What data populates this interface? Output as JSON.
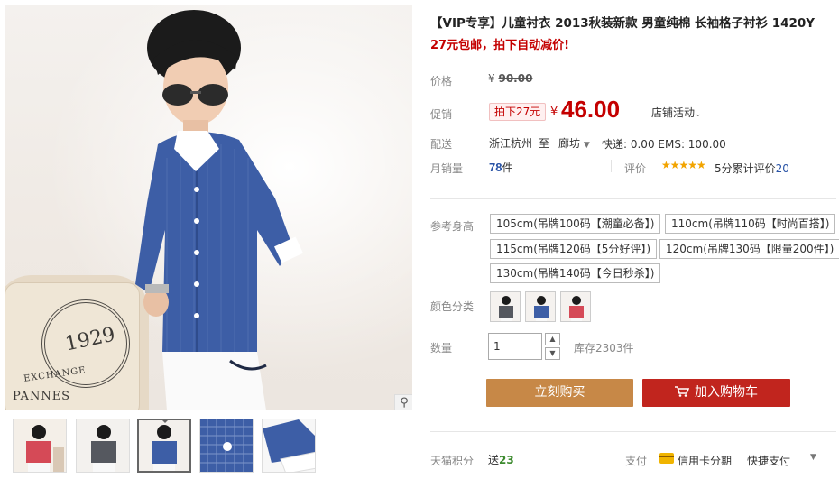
{
  "product": {
    "title": "【VIP专享】儿童衬衣 2013秋装新款 男童纯棉 长袖格子衬衫 1420Y",
    "subtitle": "27元包邮，拍下自动减价!"
  },
  "price": {
    "label": "价格",
    "original": "90.00",
    "currency_symbol": "¥"
  },
  "promo": {
    "label": "促销",
    "tag": "拍下27元",
    "currency_symbol": "¥",
    "price": "46.00",
    "shop_activity": "店铺活动"
  },
  "delivery": {
    "label": "配送",
    "from": "浙江杭州",
    "to_word": "至",
    "destination": "廊坊",
    "shipping": "快递: 0.00 EMS: 100.00"
  },
  "sales": {
    "label": "月销量",
    "count": "78",
    "unit": "件",
    "rating_label": "评价",
    "stars": "★★★★★",
    "score_text": "5分",
    "cumulative_text": "累计评价",
    "review_count": "20"
  },
  "size": {
    "label": "参考身高",
    "options": [
      "105cm(吊牌100码【潮童必备】)",
      "110cm(吊牌110码【时尚百搭】)",
      "115cm(吊牌120码【5分好评】)",
      "120cm(吊牌130码【限量200件】)",
      "130cm(吊牌140码【今日秒杀】)"
    ]
  },
  "color": {
    "label": "颜色分类",
    "options": [
      "gray-shirt",
      "blue-shirt",
      "red-shirt"
    ]
  },
  "quantity": {
    "label": "数量",
    "value": "1",
    "up_icon": "▲",
    "down_icon": "▼",
    "stock": "库存2303件"
  },
  "actions": {
    "buy_now": "立刻购买",
    "add_to_cart": "加入购物车"
  },
  "footer": {
    "points_label": "天猫积分",
    "points_prefix": "送",
    "points_value": "23",
    "pay_label": "支付",
    "installment": "信用卡分期",
    "quick_pay": "快捷支付"
  },
  "colors": {
    "accent_red": "#c40000",
    "buy_button": "#c78847",
    "cart_button": "#c1251e",
    "shirt_blue": "#3d5ea6"
  },
  "icons": {
    "zoom": "magnifier-icon",
    "cart": "cart-icon"
  }
}
